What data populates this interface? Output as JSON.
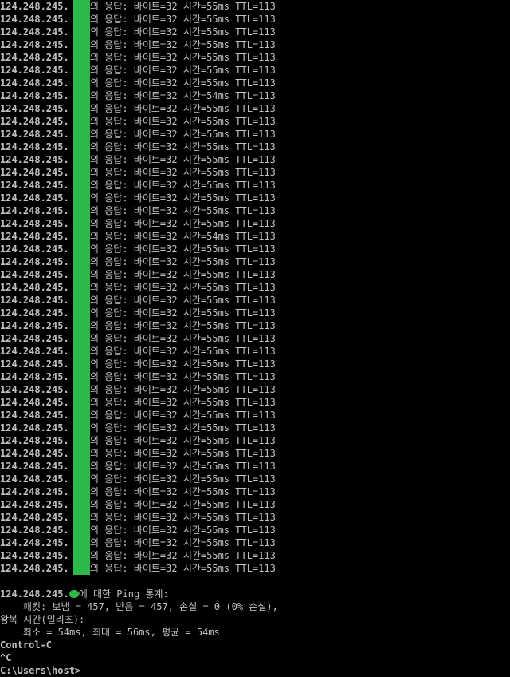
{
  "terminal": {
    "background": "#000000",
    "text_color": "#c0c0c0",
    "redaction_color": "#2db84a",
    "ip_prefix": "124.248.245.",
    "reply_lines": [
      {
        "response": "의 응답: 바이트=32 시간=55ms TTL=113"
      },
      {
        "response": "의 응답: 바이트=32 시간=55ms TTL=113"
      },
      {
        "response": "의 응답: 바이트=32 시간=55ms TTL=113"
      },
      {
        "response": "의 응답: 바이트=32 시간=55ms TTL=113"
      },
      {
        "response": "의 응답: 바이트=32 시간=55ms TTL=113"
      },
      {
        "response": "의 응답: 바이트=32 시간=55ms TTL=113"
      },
      {
        "response": "의 응답: 바이트=32 시간=55ms TTL=113"
      },
      {
        "response": "의 응답: 바이트=32 시간=54ms TTL=113"
      },
      {
        "response": "의 응답: 바이트=32 시간=55ms TTL=113"
      },
      {
        "response": "의 응답: 바이트=32 시간=55ms TTL=113"
      },
      {
        "response": "의 응답: 바이트=32 시간=55ms TTL=113"
      },
      {
        "response": "의 응답: 바이트=32 시간=55ms TTL=113"
      },
      {
        "response": "의 응답: 바이트=32 시간=55ms TTL=113"
      },
      {
        "response": "의 응답: 바이트=32 시간=55ms TTL=113"
      },
      {
        "response": "의 응답: 바이트=32 시간=55ms TTL=113"
      },
      {
        "response": "의 응답: 바이트=32 시간=55ms TTL=113"
      },
      {
        "response": "의 응답: 바이트=32 시간=55ms TTL=113"
      },
      {
        "response": "의 응답: 바이트=32 시간=55ms TTL=113"
      },
      {
        "response": "의 응답: 바이트=32 시간=54ms TTL=113"
      },
      {
        "response": "의 응답: 바이트=32 시간=55ms TTL=113"
      },
      {
        "response": "의 응답: 바이트=32 시간=55ms TTL=113"
      },
      {
        "response": "의 응답: 바이트=32 시간=55ms TTL=113"
      },
      {
        "response": "의 응답: 바이트=32 시간=55ms TTL=113"
      },
      {
        "response": "의 응답: 바이트=32 시간=55ms TTL=113"
      },
      {
        "response": "의 응답: 바이트=32 시간=55ms TTL=113"
      },
      {
        "response": "의 응답: 바이트=32 시간=55ms TTL=113"
      },
      {
        "response": "의 응답: 바이트=32 시간=55ms TTL=113"
      },
      {
        "response": "의 응답: 바이트=32 시간=55ms TTL=113"
      },
      {
        "response": "의 응답: 바이트=32 시간=55ms TTL=113"
      },
      {
        "response": "의 응답: 바이트=32 시간=55ms TTL=113"
      },
      {
        "response": "의 응답: 바이트=32 시간=55ms TTL=113"
      },
      {
        "response": "의 응답: 바이트=32 시간=55ms TTL=113"
      },
      {
        "response": "의 응답: 바이트=32 시간=55ms TTL=113"
      },
      {
        "response": "의 응답: 바이트=32 시간=55ms TTL=113"
      },
      {
        "response": "의 응답: 바이트=32 시간=55ms TTL=113"
      },
      {
        "response": "의 응답: 바이트=32 시간=55ms TTL=113"
      },
      {
        "response": "의 응답: 바이트=32 시간=55ms TTL=113"
      },
      {
        "response": "의 응답: 바이트=32 시간=55ms TTL=113"
      },
      {
        "response": "의 응답: 바이트=32 시간=55ms TTL=113"
      },
      {
        "response": "의 응답: 바이트=32 시간=55ms TTL=113"
      },
      {
        "response": "의 응답: 바이트=32 시간=55ms TTL=113"
      },
      {
        "response": "의 응답: 바이트=32 시간=55ms TTL=113"
      },
      {
        "response": "의 응답: 바이트=32 시간=55ms TTL=113"
      },
      {
        "response": "의 응답: 바이트=32 시간=55ms TTL=113"
      },
      {
        "response": "의 응답: 바이트=32 시간=55ms TTL=113"
      }
    ],
    "stats": {
      "header_suffix": "에 대한 Ping 통계:",
      "packets": "    패킷: 보냄 = 457, 받음 = 457, 손실 = 0 (0% 손실),",
      "rtt_header": "왕복 시간(밀리초):",
      "rtt_values": "    최소 = 54ms, 최대 = 56ms, 평균 = 54ms"
    },
    "trailer": {
      "control_c": "Control-C",
      "caret_c": "^C",
      "prompt": "C:\\Users\\host>"
    }
  }
}
